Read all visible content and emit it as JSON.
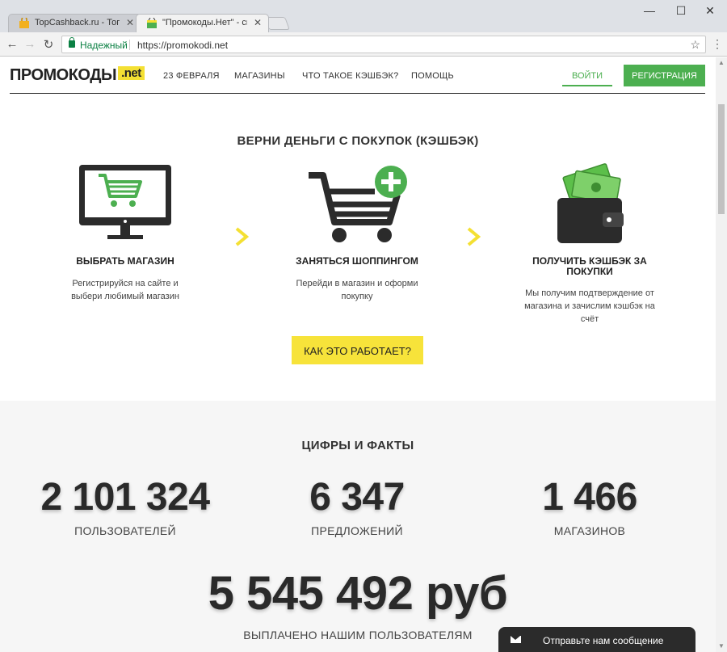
{
  "browser": {
    "tabs": [
      {
        "label": "TopCashback.ru - Топ лу",
        "close": "✕"
      },
      {
        "label": "\"Промокоды.Нет\" - ски",
        "close": "✕"
      }
    ],
    "window_controls": {
      "minimize": "—",
      "maximize": "☐",
      "close": "✕"
    },
    "nav": {
      "back": "←",
      "forward": "→",
      "reload": "↻"
    },
    "secure_label": "Надежный",
    "url": "https://promokodi.net",
    "star": "☆",
    "menu": "⋮"
  },
  "header": {
    "logo_text": "ПРОМОКОДЫ",
    "logo_badge": ".net",
    "nav": [
      "23 ФЕВРАЛЯ",
      "МАГАЗИНЫ",
      "ЧТО ТАКОЕ КЭШБЭК?",
      "ПОМОЩЬ"
    ],
    "login": "ВОЙТИ",
    "register": "РЕГИСТРАЦИЯ"
  },
  "how": {
    "title": "ВЕРНИ ДЕНЬГИ С ПОКУПОК (КЭШБЭК)",
    "steps": [
      {
        "title": "ВЫБРАТЬ МАГАЗИН",
        "desc": "Регистрируйся на сайте и выбери любимый магазин",
        "icon": "monitor-cart-icon"
      },
      {
        "title": "ЗАНЯТЬСЯ ШОППИНГОМ",
        "desc": "Перейди в магазин и оформи покупку",
        "icon": "shopping-cart-plus-icon"
      },
      {
        "title": "ПОЛУЧИТЬ КЭШБЭК ЗА ПОКУПКИ",
        "desc": "Мы получим подтверждение от магазина и зачислим кэшбэк на счёт",
        "icon": "wallet-money-icon"
      }
    ],
    "button": "КАК ЭТО РАБОТАЕТ?"
  },
  "facts": {
    "title": "ЦИФРЫ И ФАКТЫ",
    "items": [
      {
        "value": "2 101 324",
        "label": "ПОЛЬЗОВАТЕЛЕЙ"
      },
      {
        "value": "6 347",
        "label": "ПРЕДЛОЖЕНИЙ"
      },
      {
        "value": "1 466",
        "label": "МАГАЗИНОВ"
      }
    ],
    "paid_value": "5 545 492 руб",
    "paid_label": "ВЫПЛАЧЕНО НАШИМ ПОЛЬЗОВАТЕЛЯМ"
  },
  "chat": {
    "label": "Отправьте нам сообщение"
  },
  "colors": {
    "green": "#4caf50",
    "yellow": "#f7e33a",
    "dark": "#2b2b2b"
  }
}
